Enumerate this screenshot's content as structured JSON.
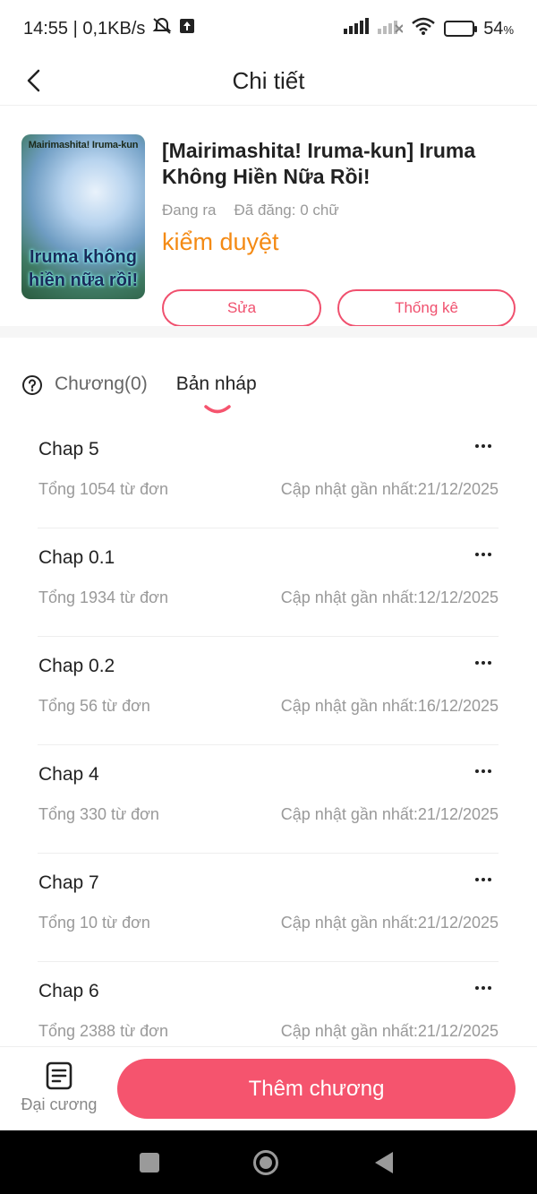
{
  "status_bar": {
    "time_speed": "14:55 | 0,1KB/s",
    "battery_percent": "54",
    "battery_unit": "%",
    "battery_level": 0.54
  },
  "header": {
    "title": "Chi tiết"
  },
  "book": {
    "cover_top_text": "Mairimashita! Iruma-kun",
    "cover_main_text": "Iruma không hiền nữa rồi!",
    "title": "[Mairimashita! Iruma-kun] Iruma Không Hiền Nữa Rồi!",
    "state": "Đang ra",
    "posted": "Đã đăng: 0 chữ",
    "review_status": "kiểm duyệt",
    "edit_label": "Sửa",
    "stats_label": "Thống kê"
  },
  "tabs": {
    "chapters_label": "Chương(0)",
    "drafts_label": "Bản nháp"
  },
  "chapters": [
    {
      "name": "Chap 5",
      "words": "Tổng 1054 từ đơn",
      "updated": "Cập nhật gần nhất:21/12/2025"
    },
    {
      "name": "Chap 0.1",
      "words": "Tổng 1934 từ đơn",
      "updated": "Cập nhật gần nhất:12/12/2025"
    },
    {
      "name": "Chap 0.2",
      "words": "Tổng 56 từ đơn",
      "updated": "Cập nhật gần nhất:16/12/2025"
    },
    {
      "name": "Chap 4",
      "words": "Tổng 330 từ đơn",
      "updated": "Cập nhật gần nhất:21/12/2025"
    },
    {
      "name": "Chap 7",
      "words": "Tổng 10 từ đơn",
      "updated": "Cập nhật gần nhất:21/12/2025"
    },
    {
      "name": "Chap 6",
      "words": "Tổng 2388 từ đơn",
      "updated": "Cập nhật gần nhất:21/12/2025"
    }
  ],
  "bottom": {
    "outline_label": "Đại cương",
    "add_chapter_label": "Thêm chương"
  },
  "icons": {
    "back": "chevron-left-icon",
    "help": "question-circle-icon",
    "outline": "document-icon",
    "more": "more-dots-icon"
  },
  "colors": {
    "accent": "#f5546e",
    "status_orange": "#f48a14"
  }
}
